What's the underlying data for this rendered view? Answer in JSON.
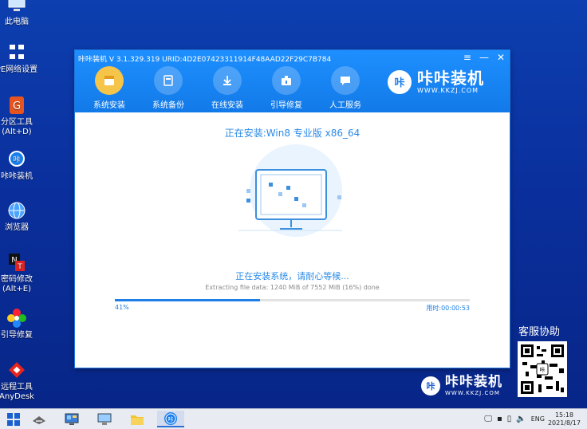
{
  "desktop": {
    "icons": [
      {
        "label": "此电脑",
        "sub": ""
      },
      {
        "label": "PE网络设置",
        "sub": ""
      },
      {
        "label": "分区工具",
        "sub": "(Alt+D)"
      },
      {
        "label": "咔咔装机",
        "sub": ""
      },
      {
        "label": "浏览器",
        "sub": ""
      },
      {
        "label": "密码修改",
        "sub": "(Alt+E)"
      },
      {
        "label": "引导修复",
        "sub": ""
      },
      {
        "label": "远程工具",
        "sub": "AnyDesk"
      }
    ]
  },
  "window": {
    "title": "咔咔装机 V 3.1.329.319 URID:4D2E07423311914F48AAD22F29C7B784",
    "controls": {
      "menu": "≡",
      "minimize": "—",
      "close": "✕"
    },
    "nav": [
      {
        "label": "系统安装",
        "icon": "system-install-icon",
        "active": true
      },
      {
        "label": "系统备份",
        "icon": "system-backup-icon",
        "active": false
      },
      {
        "label": "在线安装",
        "icon": "online-install-icon",
        "active": false
      },
      {
        "label": "引导修复",
        "icon": "boot-repair-icon",
        "active": false
      },
      {
        "label": "人工服务",
        "icon": "chat-service-icon",
        "active": false
      }
    ],
    "brand": {
      "logo": "咔",
      "name": "咔咔装机",
      "url": "WWW.KKZJ.COM"
    },
    "status_title": "正在安装:Win8 专业版 x86_64",
    "install_message": "正在安装系统，请耐心等候...",
    "extract_message": "Extracting file data: 1240 MiB of 7552 MiB (16%) done",
    "progress": {
      "value": 0.41,
      "percent_label": "41%",
      "elapsed_label": "用时:00:00:53"
    }
  },
  "side": {
    "help_title": "客服协助",
    "brand": {
      "logo": "咔",
      "name": "咔咔装机",
      "url": "WWW.KKZJ.COM"
    }
  },
  "taskbar": {
    "tray": {
      "lang": "ENG",
      "time": "15:18",
      "date": "2021/8/17"
    }
  },
  "colors": {
    "accent": "#1e88ff",
    "nav_active": "#f5c54a",
    "desktop": "#0a2f9c"
  }
}
